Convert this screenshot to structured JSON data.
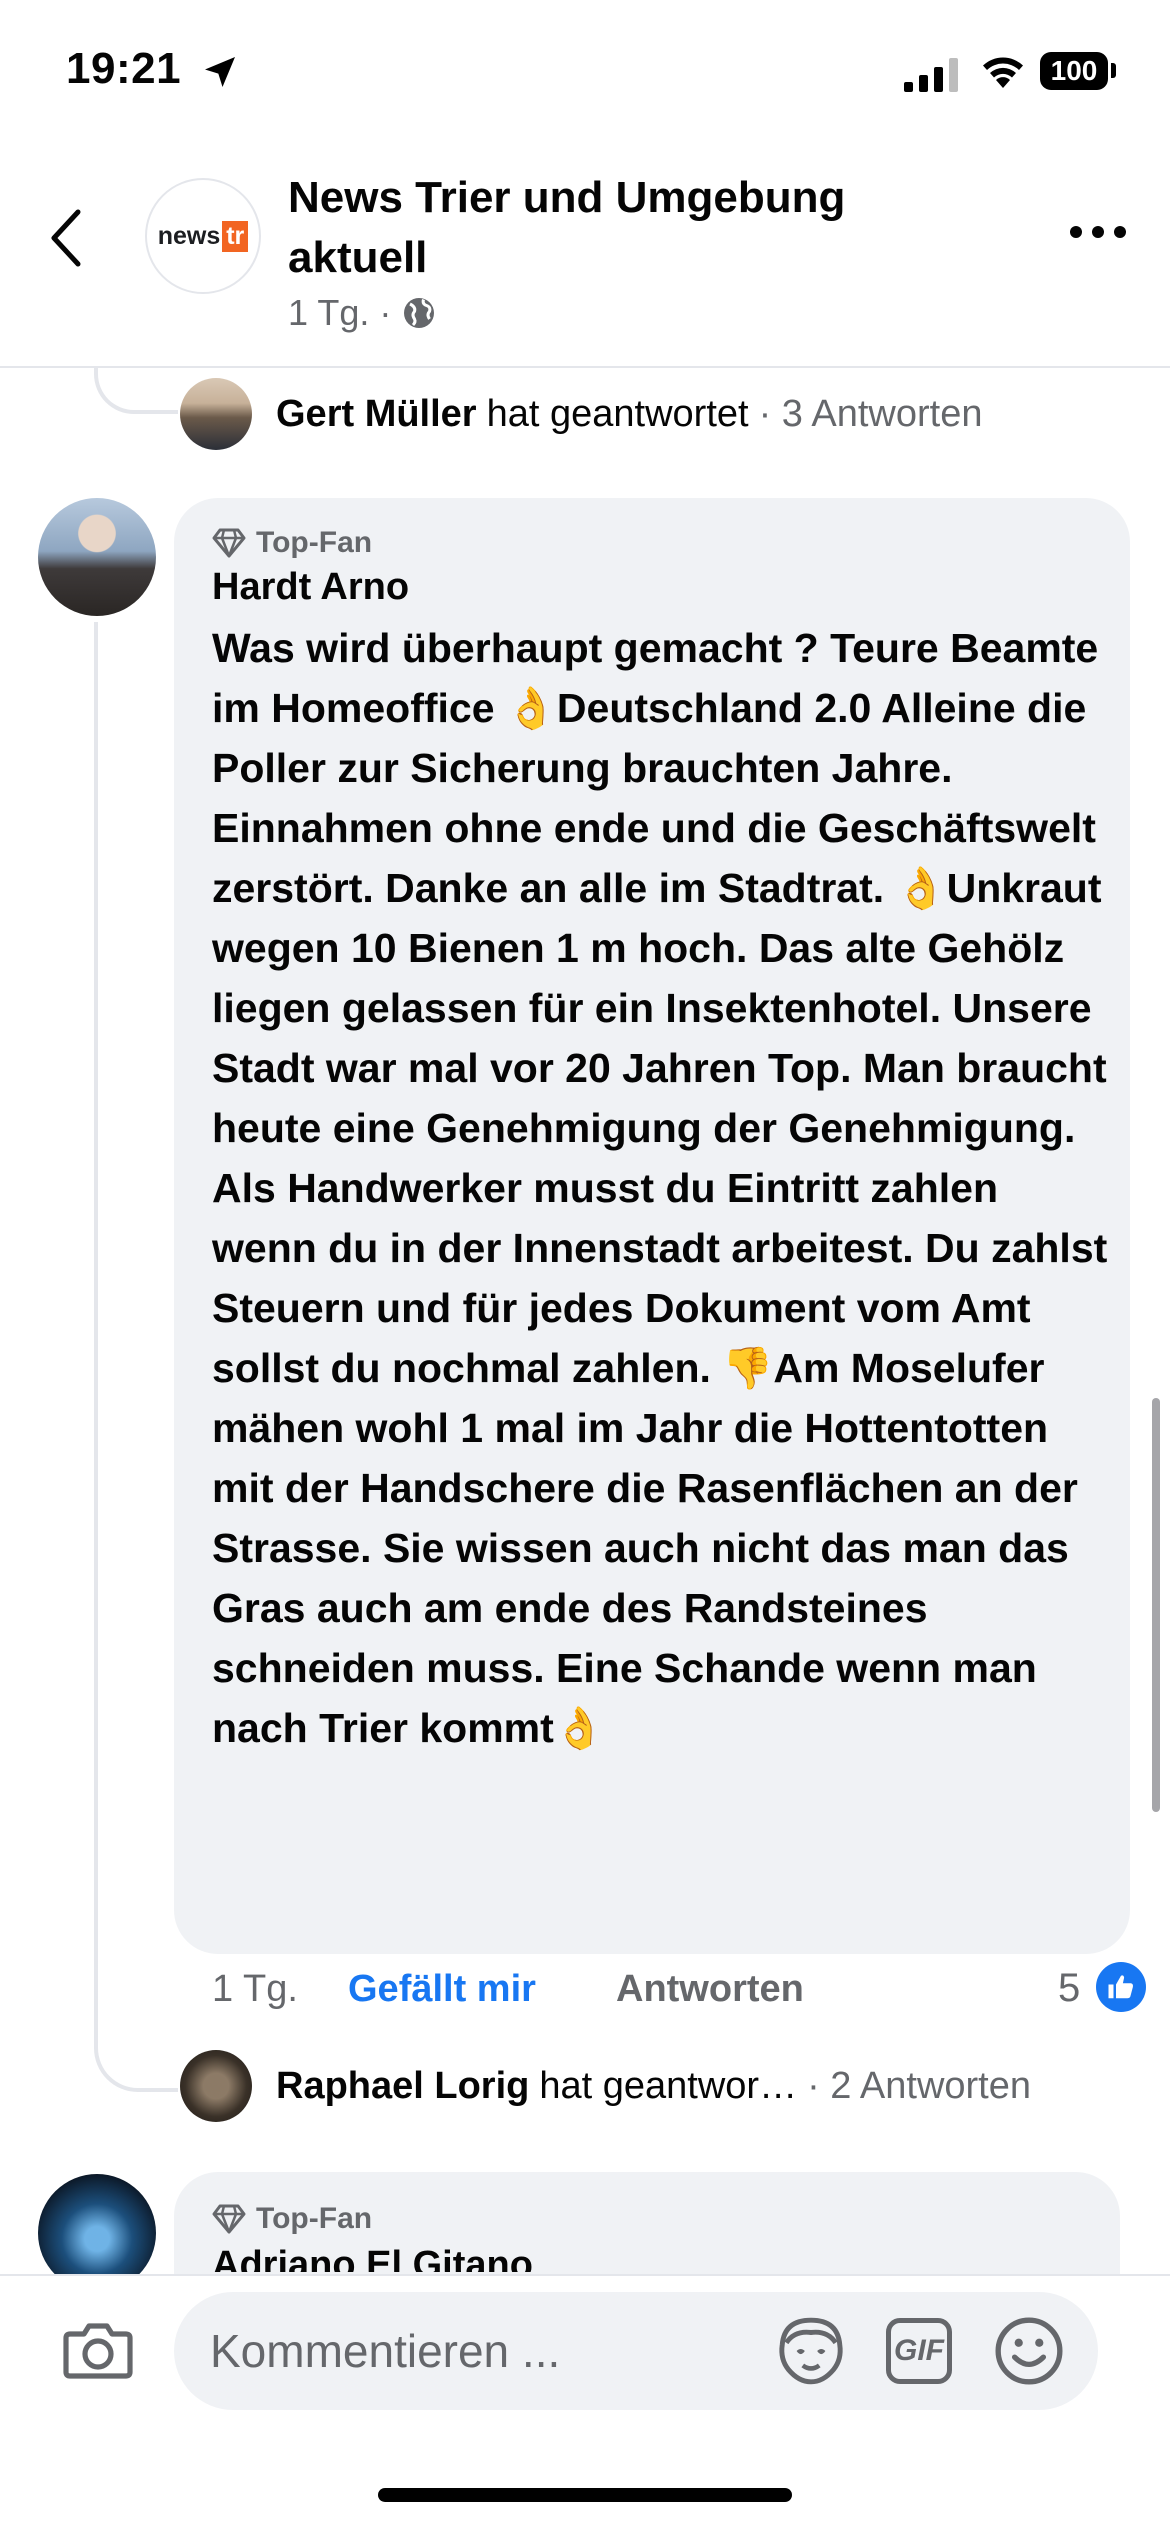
{
  "status_bar": {
    "time": "19:21",
    "battery": "100"
  },
  "header": {
    "page_name": "News Trier und Umgebung aktuell",
    "post_age": "1 Tg.",
    "separator": "·",
    "logo_news": "news",
    "logo_tr": "tr"
  },
  "reply_rows": [
    {
      "name": "Gert Müller",
      "action": "hat geantwortet",
      "count": "· 3 Antworten"
    },
    {
      "name": "Raphael Lorig",
      "action": "hat geantwor…",
      "count": "· 2 Antworten"
    }
  ],
  "comment": {
    "badge": "Top-Fan",
    "author": "Hardt Arno",
    "text": "Was wird überhaupt gemacht ? Teure Beamte im Homeoffice 👌Deutschland 2.0 Alleine die Poller zur Sicherung brauchten Jahre. Einnahmen ohne ende und die Geschäftswelt zerstört. Danke an alle im Stadtrat.  👌Unkraut wegen 10 Bienen 1 m hoch. Das alte Gehölz liegen gelassen für ein Insektenhotel. Unsere Stadt war mal vor 20 Jahren Top. Man braucht heute eine Genehmigung der Genehmigung. Als Handwerker musst du Eintritt zahlen wenn du in der Innenstadt arbeitest. Du zahlst Steuern und für jedes Dokument vom Amt sollst du nochmal zahlen. 👎Am Moselufer mähen wohl 1 mal im Jahr die Hottentotten mit der Handschere die Rasenflächen an der Strasse. Sie wissen auch nicht das man das Gras auch am ende des Randsteines schneiden muss. Eine Schande wenn man nach Trier kommt👌",
    "time": "1 Tg.",
    "like_label": "Gefällt mir",
    "reply_label": "Antworten",
    "like_count": "5"
  },
  "next_comment": {
    "badge": "Top-Fan",
    "author": "Adriano El Gitano"
  },
  "composer": {
    "placeholder": "Kommentieren ..."
  },
  "icons": {
    "back": "chevron-left-icon",
    "more": "more-horizontal-icon",
    "globe": "globe-icon",
    "camera": "camera-icon",
    "avatar_sticker": "avatar-sticker-icon",
    "gif": "GIF",
    "emoji": "emoji-icon",
    "like": "thumbs-up-icon",
    "diamond": "diamond-icon"
  },
  "colors": {
    "accent": "#1877f2",
    "bubble": "#f0f2f5",
    "secondary_text": "#65676b",
    "logo_orange": "#f26522"
  }
}
